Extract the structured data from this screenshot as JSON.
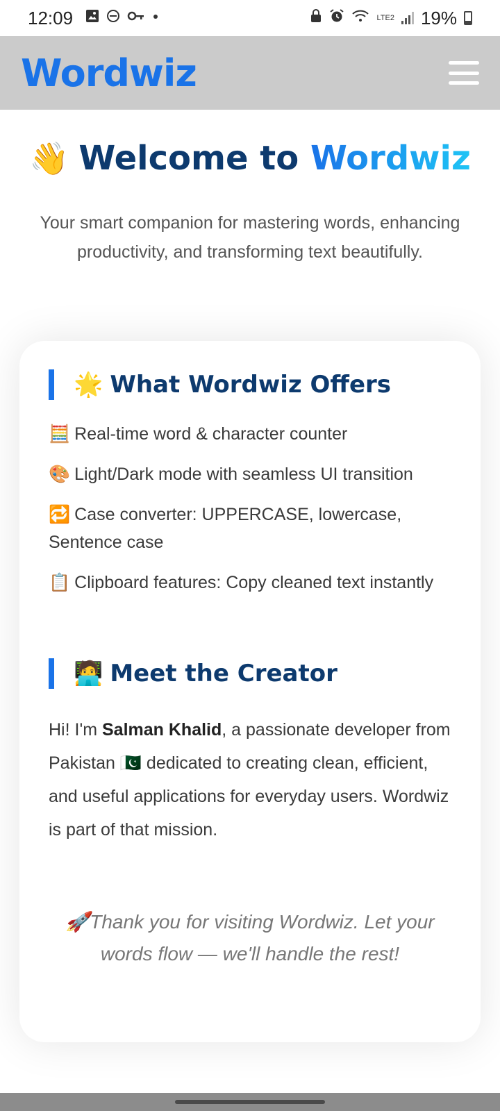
{
  "status_bar": {
    "time": "12:09",
    "battery": "19%",
    "network": "LTE2",
    "icons": [
      "gallery-icon",
      "dnd-icon",
      "key-icon",
      "dot-icon",
      "lock-icon",
      "alarm-icon",
      "wifi-icon",
      "signal-icon",
      "battery-icon"
    ]
  },
  "app_bar": {
    "brand": "Wordwiz",
    "brand_color": "#1a73e8",
    "menu_icon": "hamburger-menu-icon"
  },
  "hero": {
    "emoji": "👋",
    "title_prefix": "Welcome to ",
    "title_accent": "Wordwiz",
    "subtitle": "Your smart companion for mastering words, enhancing productivity, and transforming text beautifully."
  },
  "offers": {
    "emoji": "🌟",
    "title": "What Wordwiz Offers",
    "items": [
      {
        "emoji": "🧮",
        "text": "Real-time word & character counter"
      },
      {
        "emoji": "🎨",
        "text": "Light/Dark mode with seamless UI transition"
      },
      {
        "emoji": "🔁",
        "text": "Case converter: UPPERCASE, lowercase, Sentence case"
      },
      {
        "emoji": "📋",
        "text": "Clipboard features: Copy cleaned text instantly"
      }
    ]
  },
  "creator": {
    "emoji": "🧑‍💻",
    "title": "Meet the Creator",
    "bio_before": "Hi! I'm ",
    "name": "Salman Khalid",
    "bio_middle": ", a passionate developer from Pakistan ",
    "flag": "🇵🇰",
    "bio_after": " dedicated to creating clean, efficient, and useful applications for everyday users. Wordwiz is part of that mission."
  },
  "thanks": {
    "emoji": "🚀",
    "text": "Thank you for visiting Wordwiz. Let your words flow — we'll handle the rest!"
  },
  "colors": {
    "heading": "#0d3a6e",
    "accent": "#1a73e8",
    "app_bar_bg": "#cbcbcb"
  }
}
